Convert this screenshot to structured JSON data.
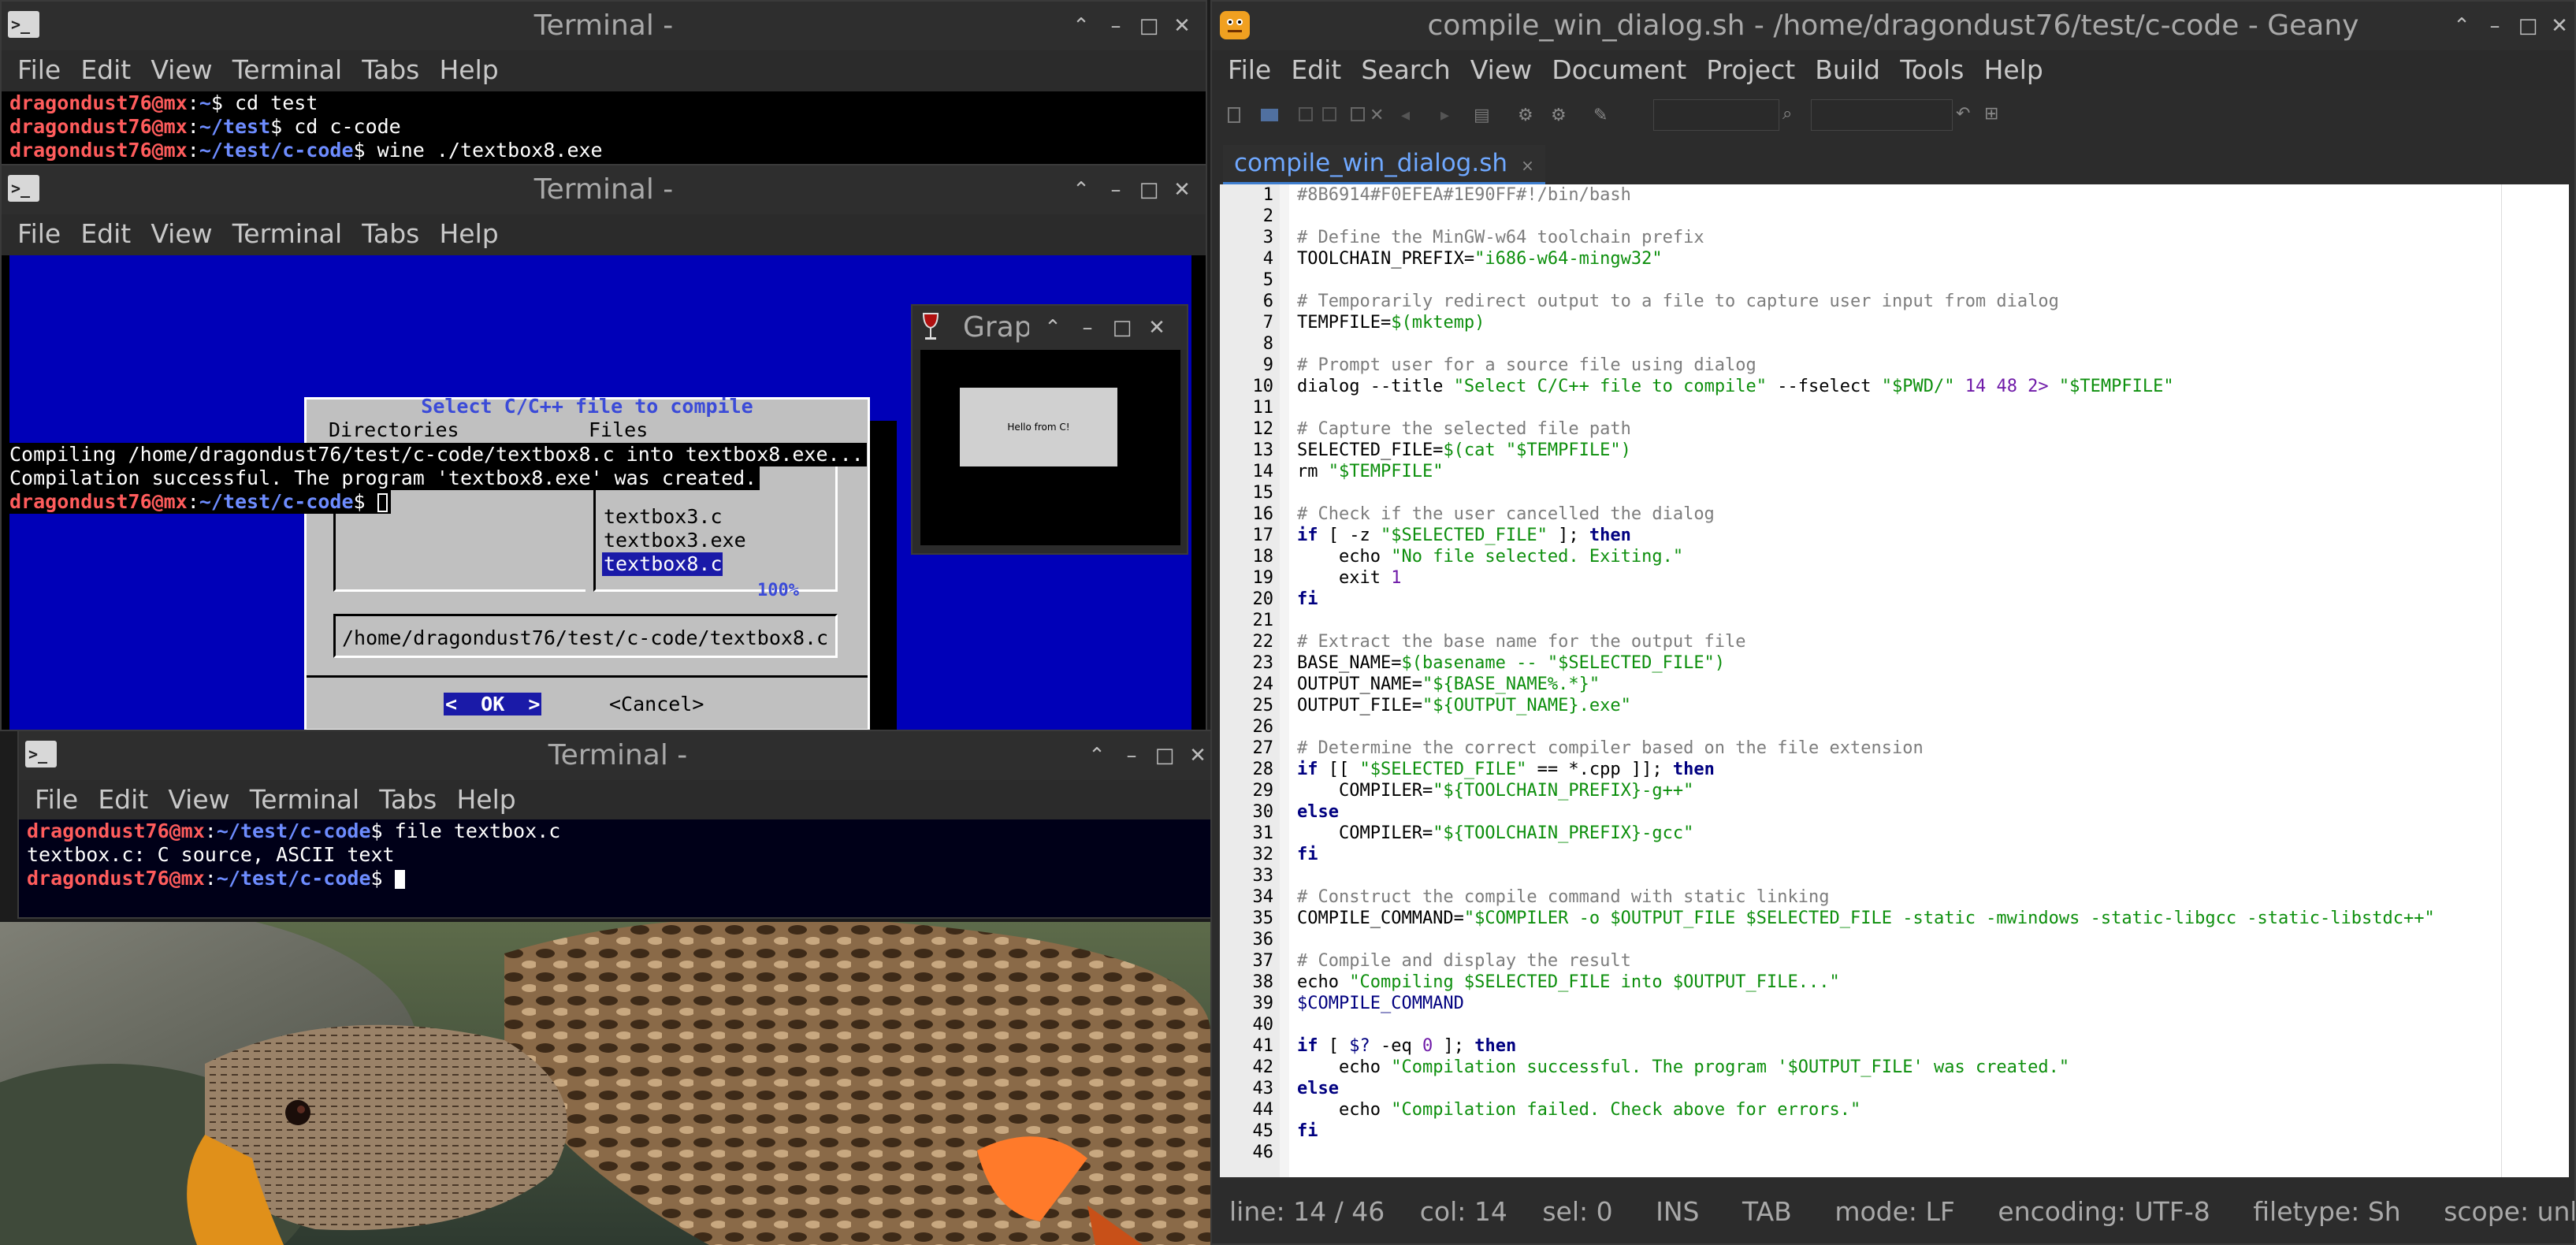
{
  "terminal1": {
    "title": "Terminal -",
    "menu": [
      "File",
      "Edit",
      "View",
      "Terminal",
      "Tabs",
      "Help"
    ],
    "lines": [
      {
        "user": "dragondust76@mx",
        "path": "~",
        "cmd": "$ cd test"
      },
      {
        "user": "dragondust76@mx",
        "path": "~/test",
        "cmd": "$ cd c-code"
      },
      {
        "user": "dragondust76@mx",
        "path": "~/test/c-code",
        "cmd": "$ wine ./textbox8.exe"
      }
    ]
  },
  "terminal2": {
    "title": "Terminal -",
    "menu": [
      "File",
      "Edit",
      "View",
      "Terminal",
      "Tabs",
      "Help"
    ],
    "output1": "Compiling /home/dragondust76/test/c-code/textbox8.c into textbox8.exe...",
    "output2": "Compilation successful. The program 'textbox8.exe' was created.",
    "prompt_user": "dragondust76@mx",
    "prompt_path": "~/test/c-code",
    "prompt_sym": "$"
  },
  "dialog": {
    "title": "Select C/C++ file to compile",
    "dirs_header": "Directories",
    "files_header": "Files",
    "files": [
      "textbox3.c",
      "textbox3.exe",
      "textbox8.c"
    ],
    "selected_file": "textbox8.c",
    "progress": "100%",
    "path": "/home/dragondust76/test/c-code/textbox8.c",
    "ok_label": "<  OK  >",
    "cancel_label": "<Cancel>"
  },
  "graph_window": {
    "title": "Graph",
    "button_text": "Hello from C!"
  },
  "terminal3": {
    "title": "Terminal -",
    "menu": [
      "File",
      "Edit",
      "View",
      "Terminal",
      "Tabs",
      "Help"
    ],
    "lines": [
      {
        "user": "dragondust76@mx",
        "path": "~/test/c-code",
        "cmd": "$ file textbox.c"
      },
      {
        "plain": "textbox.c: C source, ASCII text"
      },
      {
        "user": "dragondust76@mx",
        "path": "~/test/c-code",
        "cmd": "$ "
      }
    ]
  },
  "geany": {
    "title": "compile_win_dialog.sh - /home/dragondust76/test/c-code - Geany",
    "menu": [
      "File",
      "Edit",
      "Search",
      "View",
      "Document",
      "Project",
      "Build",
      "Tools",
      "Help"
    ],
    "tab": "compile_win_dialog.sh",
    "tab_close": "×",
    "code": [
      [
        {
          "t": "#8B6914#F0EFEA#1E90FF#!/bin/bash",
          "c": "cm"
        }
      ],
      [],
      [
        {
          "t": "# Define the MinGW-w64 toolchain prefix",
          "c": "cm"
        }
      ],
      [
        {
          "t": "TOOLCHAIN_PREFIX="
        },
        {
          "t": "\"i686-w64-mingw32\"",
          "c": "st"
        }
      ],
      [],
      [
        {
          "t": "# Temporarily redirect output to a file to capture user input from dialog",
          "c": "cm"
        }
      ],
      [
        {
          "t": "TEMPFILE="
        },
        {
          "t": "$(mktemp)",
          "c": "st"
        }
      ],
      [],
      [
        {
          "t": "# Prompt user for a source file using dialog",
          "c": "cm"
        }
      ],
      [
        {
          "t": "dialog --title "
        },
        {
          "t": "\"Select C/C++ file to compile\"",
          "c": "st"
        },
        {
          "t": " --fselect "
        },
        {
          "t": "\"$PWD/\"",
          "c": "st"
        },
        {
          "t": " 14 48 2> ",
          "c": "nm"
        },
        {
          "t": "\"$TEMPFILE\"",
          "c": "st"
        }
      ],
      [],
      [
        {
          "t": "# Capture the selected file path",
          "c": "cm"
        }
      ],
      [
        {
          "t": "SELECTED_FILE="
        },
        {
          "t": "$(cat \"$TEMPFILE\")",
          "c": "st"
        }
      ],
      [
        {
          "t": "rm "
        },
        {
          "t": "\"$TEMPFILE\"",
          "c": "st"
        }
      ],
      [],
      [
        {
          "t": "# Check if the user cancelled the dialog",
          "c": "cm"
        }
      ],
      [
        {
          "t": "if",
          "c": "kw"
        },
        {
          "t": " [ -z "
        },
        {
          "t": "\"$SELECTED_FILE\"",
          "c": "st"
        },
        {
          "t": " ]; "
        },
        {
          "t": "then",
          "c": "kw"
        }
      ],
      [
        {
          "t": "    echo "
        },
        {
          "t": "\"No file selected. Exiting.\"",
          "c": "st"
        }
      ],
      [
        {
          "t": "    exit "
        },
        {
          "t": "1",
          "c": "nm"
        }
      ],
      [
        {
          "t": "fi",
          "c": "kw"
        }
      ],
      [],
      [
        {
          "t": "# Extract the base name for the output file",
          "c": "cm"
        }
      ],
      [
        {
          "t": "BASE_NAME="
        },
        {
          "t": "$(basename -- \"$SELECTED_FILE\")",
          "c": "st"
        }
      ],
      [
        {
          "t": "OUTPUT_NAME="
        },
        {
          "t": "\"${BASE_NAME%.*}\"",
          "c": "st"
        }
      ],
      [
        {
          "t": "OUTPUT_FILE="
        },
        {
          "t": "\"${OUTPUT_NAME}.exe\"",
          "c": "st"
        }
      ],
      [],
      [
        {
          "t": "# Determine the correct compiler based on the file extension",
          "c": "cm"
        }
      ],
      [
        {
          "t": "if",
          "c": "kw"
        },
        {
          "t": " [[ "
        },
        {
          "t": "\"$SELECTED_FILE\"",
          "c": "st"
        },
        {
          "t": " == *.cpp ]]; "
        },
        {
          "t": "then",
          "c": "kw"
        }
      ],
      [
        {
          "t": "    COMPILER="
        },
        {
          "t": "\"${TOOLCHAIN_PREFIX}-g++\"",
          "c": "st"
        }
      ],
      [
        {
          "t": "else",
          "c": "kw"
        }
      ],
      [
        {
          "t": "    COMPILER="
        },
        {
          "t": "\"${TOOLCHAIN_PREFIX}-gcc\"",
          "c": "st"
        }
      ],
      [
        {
          "t": "fi",
          "c": "kw"
        }
      ],
      [],
      [
        {
          "t": "# Construct the compile command with static linking",
          "c": "cm"
        }
      ],
      [
        {
          "t": "COMPILE_COMMAND="
        },
        {
          "t": "\"$COMPILER -o $OUTPUT_FILE $SELECTED_FILE -static -mwindows -static-libgcc -static-libstdc++\"",
          "c": "st"
        }
      ],
      [],
      [
        {
          "t": "# Compile and display the result",
          "c": "cm"
        }
      ],
      [
        {
          "t": "echo "
        },
        {
          "t": "\"Compiling $SELECTED_FILE into $OUTPUT_FILE...\"",
          "c": "st"
        }
      ],
      [
        {
          "t": "$COMPILE_COMMAND",
          "c": "va"
        }
      ],
      [],
      [
        {
          "t": "if",
          "c": "kw"
        },
        {
          "t": " [ "
        },
        {
          "t": "$?",
          "c": "va"
        },
        {
          "t": " -eq "
        },
        {
          "t": "0",
          "c": "nm"
        },
        {
          "t": " ]; "
        },
        {
          "t": "then",
          "c": "kw"
        }
      ],
      [
        {
          "t": "    echo "
        },
        {
          "t": "\"Compilation successful. The program '$OUTPUT_FILE' was created.\"",
          "c": "st"
        }
      ],
      [
        {
          "t": "else",
          "c": "kw"
        }
      ],
      [
        {
          "t": "    echo "
        },
        {
          "t": "\"Compilation failed. Check above for errors.\"",
          "c": "st"
        }
      ],
      [
        {
          "t": "fi",
          "c": "kw"
        }
      ],
      []
    ],
    "status": {
      "line": "line: 14 / 46",
      "col": "col: 14",
      "sel": "sel: 0",
      "ins": "INS",
      "tab": "TAB",
      "mode": "mode: LF",
      "encoding": "encoding: UTF-8",
      "filetype": "filetype: Sh",
      "scope": "scope: unknown"
    }
  },
  "colors": {
    "terminal_bg": "#000000",
    "user": "#ff5c5c",
    "path": "#6d8cff",
    "dialog_bg": "#0000b8",
    "dialog_box": "#c0c0c0",
    "editor_bg": "#ffffff",
    "string": "#0d8f0d",
    "comment": "#7d7d7d"
  }
}
